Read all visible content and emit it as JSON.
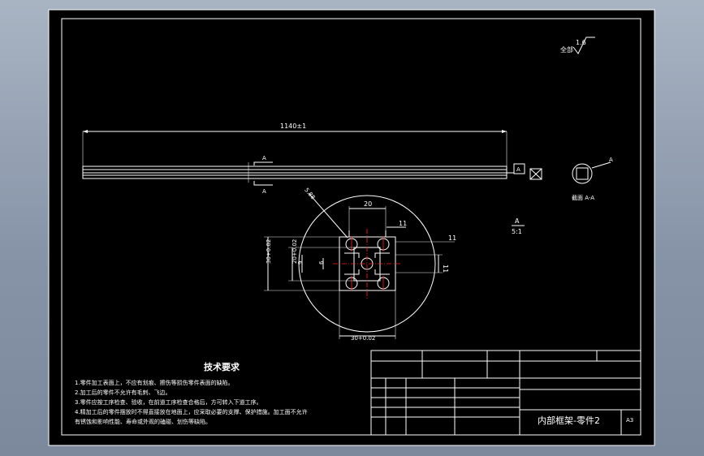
{
  "drawing": {
    "roughness": {
      "label": "全部",
      "value": "1.6"
    },
    "overall_length": "1140±1",
    "section_marker": "A",
    "section_view_label": "截面 A-A",
    "detail_label": "A",
    "detail_scale": "5:1",
    "dims": {
      "top_width": "20",
      "right_small": "11",
      "right_offset": "11",
      "right_height": "11",
      "chamfer": "5.88",
      "left_outer": "30+0.02\n30+0.01",
      "left_inner": "20+0.02\n20+0.01",
      "small_9": "9",
      "small_6": "6",
      "bottom": "30+0.02\n30+0.01"
    },
    "tech_requirements": {
      "title": "技术要求",
      "items": [
        "1.零件加工表面上，不应有划痕、擦伤等损伤零件表面的缺陷。",
        "2.加工后的零件不允许有毛刺、飞边。",
        "3.零件应按工序检查、验收，在前道工序检查合格后，方可转入下道工序。",
        "4.精加工后的零件摆放时不得直接放在地面上，应采取必要的支撑、保护措施。加工面不允许",
        "  有锈蚀和影响性能、寿命或外观的磕碰、划伤等缺陷。"
      ]
    },
    "title_block": {
      "part_name": "内部框架-零件2",
      "sheet": "A3",
      "cell_small": "A3"
    }
  },
  "colors": {
    "background": "#000000",
    "line": "#ffffff",
    "center_line": "#ff2020",
    "frame_outer": "#0a0a0a"
  }
}
